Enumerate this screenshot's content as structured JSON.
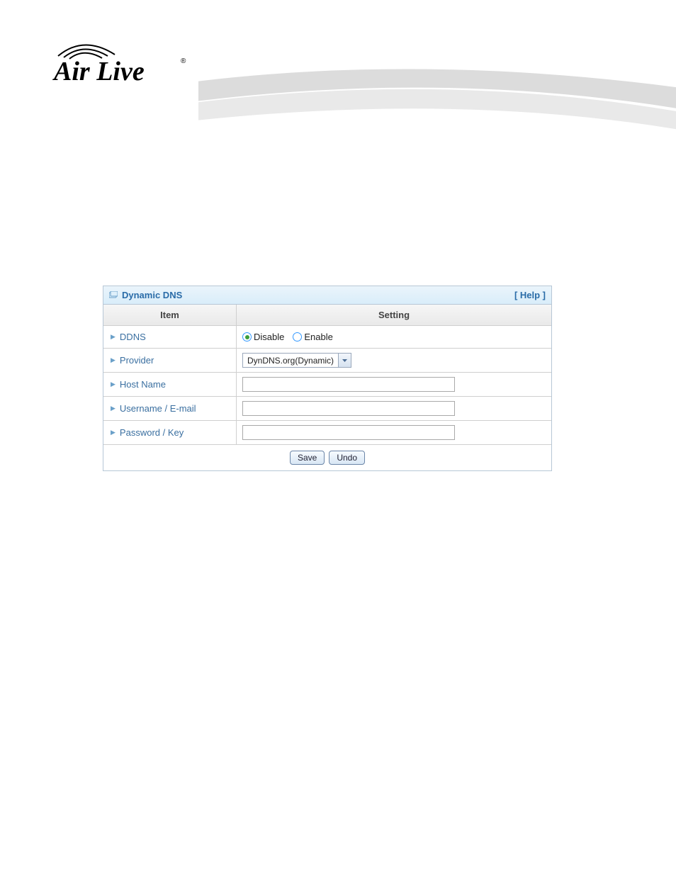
{
  "brand": "Air Live",
  "panel": {
    "title": "Dynamic DNS",
    "help_label": "[ Help ]",
    "columns": {
      "item": "Item",
      "setting": "Setting"
    },
    "rows": {
      "ddns": {
        "label": "DDNS",
        "options": {
          "disable": "Disable",
          "enable": "Enable"
        },
        "selected": "disable"
      },
      "provider": {
        "label": "Provider",
        "value": "DynDNS.org(Dynamic)"
      },
      "hostname": {
        "label": "Host Name",
        "value": ""
      },
      "username": {
        "label": "Username / E-mail",
        "value": ""
      },
      "password": {
        "label": "Password / Key",
        "value": ""
      }
    },
    "buttons": {
      "save": "Save",
      "undo": "Undo"
    }
  }
}
